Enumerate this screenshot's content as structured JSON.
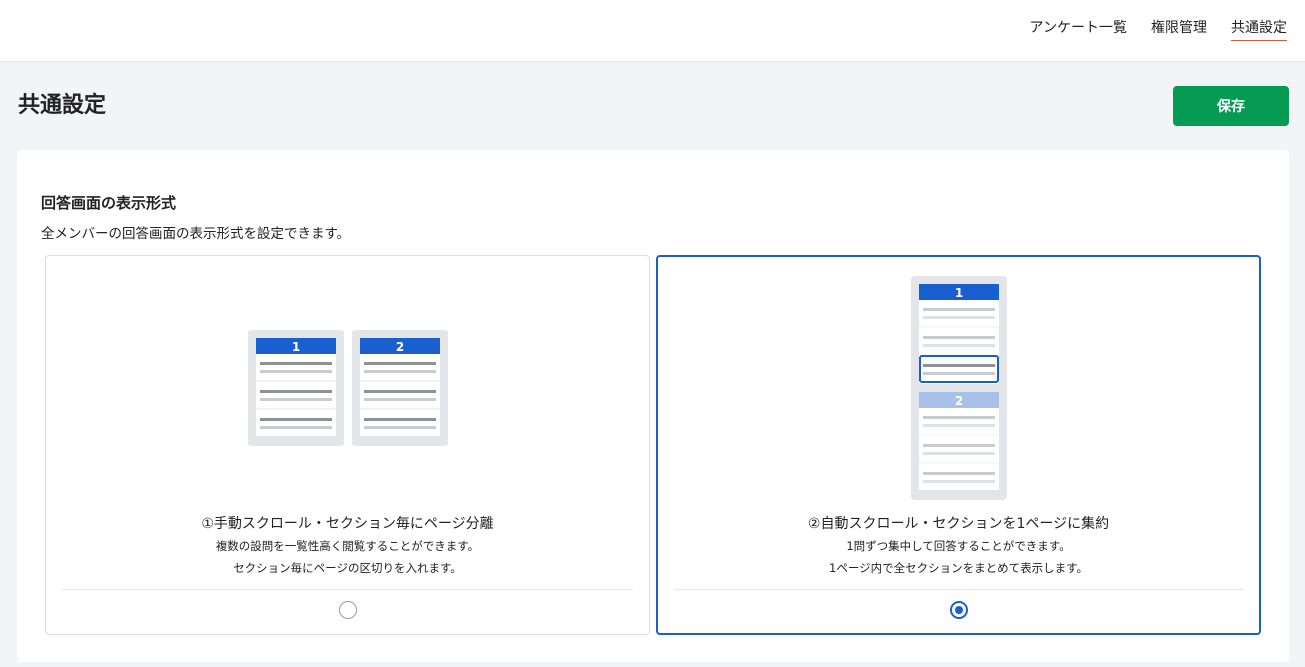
{
  "nav": {
    "items": [
      {
        "label": "アンケート一覧"
      },
      {
        "label": "権限管理"
      },
      {
        "label": "共通設定"
      }
    ]
  },
  "page": {
    "title": "共通設定",
    "save_label": "保存"
  },
  "section": {
    "title": "回答画面の表示形式",
    "description": "全メンバーの回答画面の表示形式を設定できます。"
  },
  "options": [
    {
      "title": "①手動スクロール・セクション毎にページ分離",
      "desc_line1": "複数の設問を一覧性高く閲覧することができます。",
      "desc_line2": "セクション毎にページの区切りを入れます。",
      "selected": false,
      "page_numbers": [
        "1",
        "2"
      ]
    },
    {
      "title": "②自動スクロール・セクションを1ページに集約",
      "desc_line1": "1問ずつ集中して回答することができます。",
      "desc_line2": "1ページ内で全セクションをまとめて表示します。",
      "selected": true,
      "page_numbers": [
        "1",
        "2"
      ]
    }
  ],
  "colors": {
    "accent": "#1a5fcf",
    "save": "#069b52",
    "active_underline": "#e2583a"
  }
}
